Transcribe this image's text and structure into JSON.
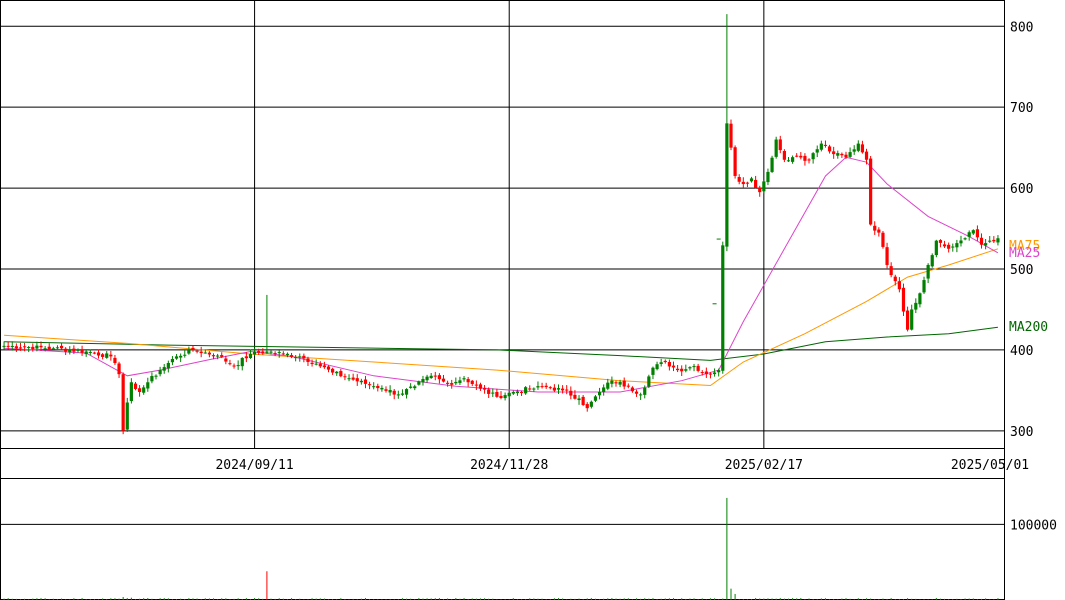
{
  "chart_data": {
    "type": "candlestick",
    "colors": {
      "up_candle": "#008000",
      "down_candle": "#ff0000",
      "ma5": "#ff9900",
      "ma25": "#dd44cc",
      "ma200": "#006600",
      "volume": "#008000",
      "volume_spike": "#ff0000",
      "grid": "#000000"
    },
    "price_axis": {
      "ylim": [
        280,
        830
      ],
      "ticks": [
        "800",
        "700",
        "600",
        "500",
        "400",
        "300"
      ]
    },
    "volume_axis": {
      "ylim": [
        0,
        160000
      ],
      "ticks": [
        "100000"
      ]
    },
    "date_ticks": [
      "2024/09/11",
      "2024/11/28",
      "2025/02/17",
      "2025/05/01"
    ],
    "ma_labels": {
      "ma5": "MA75",
      "ma25": "MA25",
      "ma200": "MA200"
    },
    "anchors": [
      {
        "i": 0,
        "c": 405
      },
      {
        "i": 12,
        "c": 402
      },
      {
        "i": 20,
        "c": 398
      },
      {
        "i": 26,
        "c": 392
      },
      {
        "i": 28,
        "c": 370
      },
      {
        "i": 29,
        "c": 300
      },
      {
        "i": 30,
        "c": 335
      },
      {
        "i": 31,
        "c": 360
      },
      {
        "i": 33,
        "c": 348
      },
      {
        "i": 35,
        "c": 360
      },
      {
        "i": 38,
        "c": 375
      },
      {
        "i": 42,
        "c": 392
      },
      {
        "i": 46,
        "c": 400
      },
      {
        "i": 52,
        "c": 393
      },
      {
        "i": 56,
        "c": 380
      },
      {
        "i": 60,
        "c": 395
      },
      {
        "i": 64,
        "c": 398
      },
      {
        "i": 68,
        "c": 395
      },
      {
        "i": 72,
        "c": 392
      },
      {
        "i": 76,
        "c": 383
      },
      {
        "i": 80,
        "c": 372
      },
      {
        "i": 84,
        "c": 365
      },
      {
        "i": 88,
        "c": 358
      },
      {
        "i": 92,
        "c": 353
      },
      {
        "i": 96,
        "c": 345
      },
      {
        "i": 100,
        "c": 355
      },
      {
        "i": 104,
        "c": 368
      },
      {
        "i": 108,
        "c": 358
      },
      {
        "i": 112,
        "c": 365
      },
      {
        "i": 116,
        "c": 352
      },
      {
        "i": 120,
        "c": 342
      },
      {
        "i": 124,
        "c": 348
      },
      {
        "i": 128,
        "c": 352
      },
      {
        "i": 132,
        "c": 354
      },
      {
        "i": 136,
        "c": 350
      },
      {
        "i": 140,
        "c": 340
      },
      {
        "i": 142,
        "c": 328
      },
      {
        "i": 145,
        "c": 348
      },
      {
        "i": 148,
        "c": 362
      },
      {
        "i": 152,
        "c": 355
      },
      {
        "i": 155,
        "c": 345
      },
      {
        "i": 158,
        "c": 378
      },
      {
        "i": 161,
        "c": 385
      },
      {
        "i": 164,
        "c": 375
      },
      {
        "i": 168,
        "c": 380
      },
      {
        "i": 171,
        "c": 370
      },
      {
        "i": 174,
        "c": 375
      },
      {
        "i": 176,
        "c": 680
      },
      {
        "i": 177,
        "c": 650
      },
      {
        "i": 178,
        "c": 615
      },
      {
        "i": 180,
        "c": 605
      },
      {
        "i": 182,
        "c": 612
      },
      {
        "i": 184,
        "c": 595
      },
      {
        "i": 186,
        "c": 620
      },
      {
        "i": 188,
        "c": 660
      },
      {
        "i": 190,
        "c": 635
      },
      {
        "i": 193,
        "c": 640
      },
      {
        "i": 196,
        "c": 635
      },
      {
        "i": 199,
        "c": 655
      },
      {
        "i": 202,
        "c": 642
      },
      {
        "i": 205,
        "c": 638
      },
      {
        "i": 208,
        "c": 655
      },
      {
        "i": 210,
        "c": 635
      },
      {
        "i": 211,
        "c": 555
      },
      {
        "i": 213,
        "c": 545
      },
      {
        "i": 215,
        "c": 505
      },
      {
        "i": 217,
        "c": 485
      },
      {
        "i": 218,
        "c": 475
      },
      {
        "i": 220,
        "c": 425
      },
      {
        "i": 221,
        "c": 450
      },
      {
        "i": 223,
        "c": 470
      },
      {
        "i": 225,
        "c": 505
      },
      {
        "i": 227,
        "c": 535
      },
      {
        "i": 230,
        "c": 525
      },
      {
        "i": 232,
        "c": 532
      },
      {
        "i": 234,
        "c": 538
      },
      {
        "i": 236,
        "c": 548
      },
      {
        "i": 238,
        "c": 530
      },
      {
        "i": 240,
        "c": 535
      },
      {
        "i": 242,
        "c": 538
      }
    ],
    "spikes": [
      {
        "i": 176,
        "h": 815
      },
      {
        "i": 64,
        "h": 468
      }
    ],
    "ma5": [
      [
        0,
        418
      ],
      [
        30,
        408
      ],
      [
        60,
        395
      ],
      [
        90,
        385
      ],
      [
        120,
        375
      ],
      [
        150,
        362
      ],
      [
        172,
        356
      ],
      [
        180,
        385
      ],
      [
        195,
        420
      ],
      [
        210,
        460
      ],
      [
        220,
        490
      ],
      [
        230,
        505
      ],
      [
        242,
        525
      ]
    ],
    "ma25": [
      [
        0,
        402
      ],
      [
        20,
        396
      ],
      [
        30,
        368
      ],
      [
        38,
        375
      ],
      [
        50,
        388
      ],
      [
        60,
        398
      ],
      [
        70,
        392
      ],
      [
        90,
        368
      ],
      [
        110,
        355
      ],
      [
        130,
        348
      ],
      [
        150,
        348
      ],
      [
        165,
        362
      ],
      [
        174,
        375
      ],
      [
        180,
        435
      ],
      [
        190,
        525
      ],
      [
        200,
        615
      ],
      [
        205,
        638
      ],
      [
        210,
        632
      ],
      [
        215,
        605
      ],
      [
        225,
        565
      ],
      [
        235,
        540
      ],
      [
        242,
        520
      ]
    ],
    "ma200": [
      [
        0,
        410
      ],
      [
        40,
        406
      ],
      [
        80,
        403
      ],
      [
        120,
        400
      ],
      [
        150,
        393
      ],
      [
        172,
        387
      ],
      [
        185,
        395
      ],
      [
        200,
        410
      ],
      [
        215,
        416
      ],
      [
        230,
        420
      ],
      [
        242,
        428
      ]
    ],
    "volume_spikes": [
      {
        "i": 176,
        "v": 135000
      },
      {
        "i": 64,
        "v": 38000
      },
      {
        "i": 29,
        "v": 4000
      },
      {
        "i": 31,
        "v": 3000
      },
      {
        "i": 177,
        "v": 15000
      },
      {
        "i": 178,
        "v": 8000
      }
    ]
  }
}
